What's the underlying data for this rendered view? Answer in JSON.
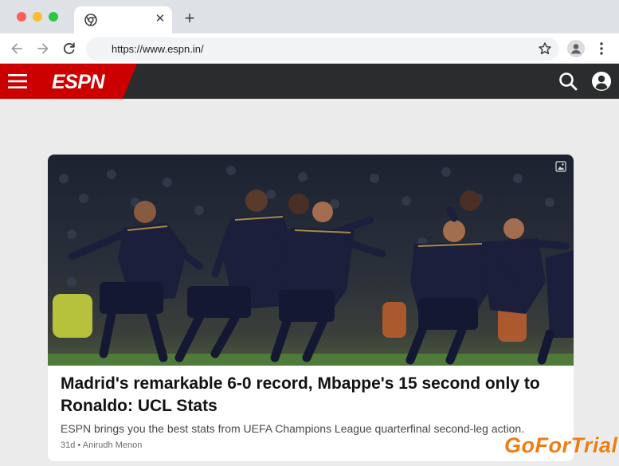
{
  "browser": {
    "url": "https://www.espn.in/",
    "close_glyph": "✕",
    "new_tab_glyph": "+",
    "icons": [
      "chrome-favicon-icon",
      "back-arrow-icon",
      "forward-arrow-icon",
      "reload-icon",
      "bookmark-star-icon",
      "profile-icon",
      "kebab-menu-icon"
    ]
  },
  "espn": {
    "logo_text": "ESPN",
    "brand_color": "#cc0000",
    "icons": [
      "hamburger-menu-icon",
      "search-icon",
      "account-icon"
    ]
  },
  "article": {
    "headline": "Madrid's remarkable 6-0 record, Mbappe's 15 second only to Ronaldo: UCL Stats",
    "summary": "ESPN brings you the best stats from UEFA Champions League quarterfinal second-leg action.",
    "age": "31d",
    "separator": "•",
    "author": "Anirudh Menon"
  },
  "watermark": {
    "text": "GoForTrial"
  }
}
